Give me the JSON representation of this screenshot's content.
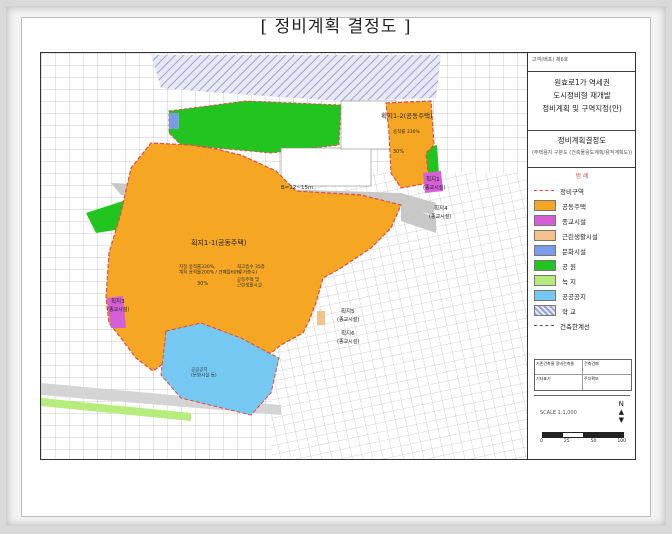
{
  "title": "[ 정비계획 결정도 ]",
  "panel": {
    "header_small": "고객(배포) 제6호",
    "plan_title_lines": [
      "원효로1가 역세권",
      "도시정비형 재개발",
      "정비계획 및 구역지정(안)"
    ],
    "decision_title": "정비계획결정도",
    "decision_sub": "(주택용지 구분도 (건축물용도계획/용적계획도))",
    "legend_header": "범 례",
    "legend": [
      {
        "label": "정비구역",
        "color": "#e34a4a",
        "kind": "line"
      },
      {
        "label": "공동주택",
        "color": "#f5a623",
        "kind": "fill"
      },
      {
        "label": "종교시설",
        "color": "#d45fd8",
        "kind": "fill"
      },
      {
        "label": "근린생활시설",
        "color": "#f6c28b",
        "kind": "fill"
      },
      {
        "label": "문화시설",
        "color": "#7a9be8",
        "kind": "fill"
      },
      {
        "label": "공 원",
        "color": "#22c41f",
        "kind": "fill"
      },
      {
        "label": "녹 지",
        "color": "#b6ec7c",
        "kind": "fill"
      },
      {
        "label": "공공공지",
        "color": "#74c8f2",
        "kind": "fill"
      },
      {
        "label": "학 교",
        "color": "#9aa0d6",
        "kind": "hatch"
      },
      {
        "label": "건축한계선",
        "color": "#555555",
        "kind": "dash"
      }
    ],
    "stamp_cells": [
      "기존건축물 정비건축물",
      "건축건폐",
      "기타표기",
      "주차확보"
    ],
    "scale_text": "SCALE 1:1,000",
    "scale_ticks": [
      "0",
      "25",
      "50",
      "100"
    ],
    "north": "N"
  },
  "map": {
    "labels": {
      "lot1": "획지1-1(공동주택)",
      "lot1_info_a": "지정 용적률330%,\n계획 용적률200% / 건폐율60%",
      "lot1_info_b": "최고층수 35층\n(주거층수)",
      "lot1_info_c": "공동주택 및\n근린생활시설",
      "lot1_pct": "30%",
      "lot2": "획지1-2(공동주택)",
      "lot2_info": "용적률 330%",
      "lot2_pct": "30%",
      "lotA": "획지1",
      "lotA_sub": "(종교시설)",
      "lotB": "획지4",
      "lotB_sub": "(종교시설)",
      "lotC": "획지3",
      "lotC_sub": "(종교시설)",
      "lotD": "획지5",
      "lotD_sub": "(종교시설)",
      "lotE": "획지6",
      "lotE_sub": "(종교시설)",
      "lotF": "획지2",
      "lotF_sub": "(종교시설)",
      "road": "B=12~15m",
      "park_note": "공공공지",
      "public_note": "공공공지\n(문화시설 등)"
    }
  }
}
